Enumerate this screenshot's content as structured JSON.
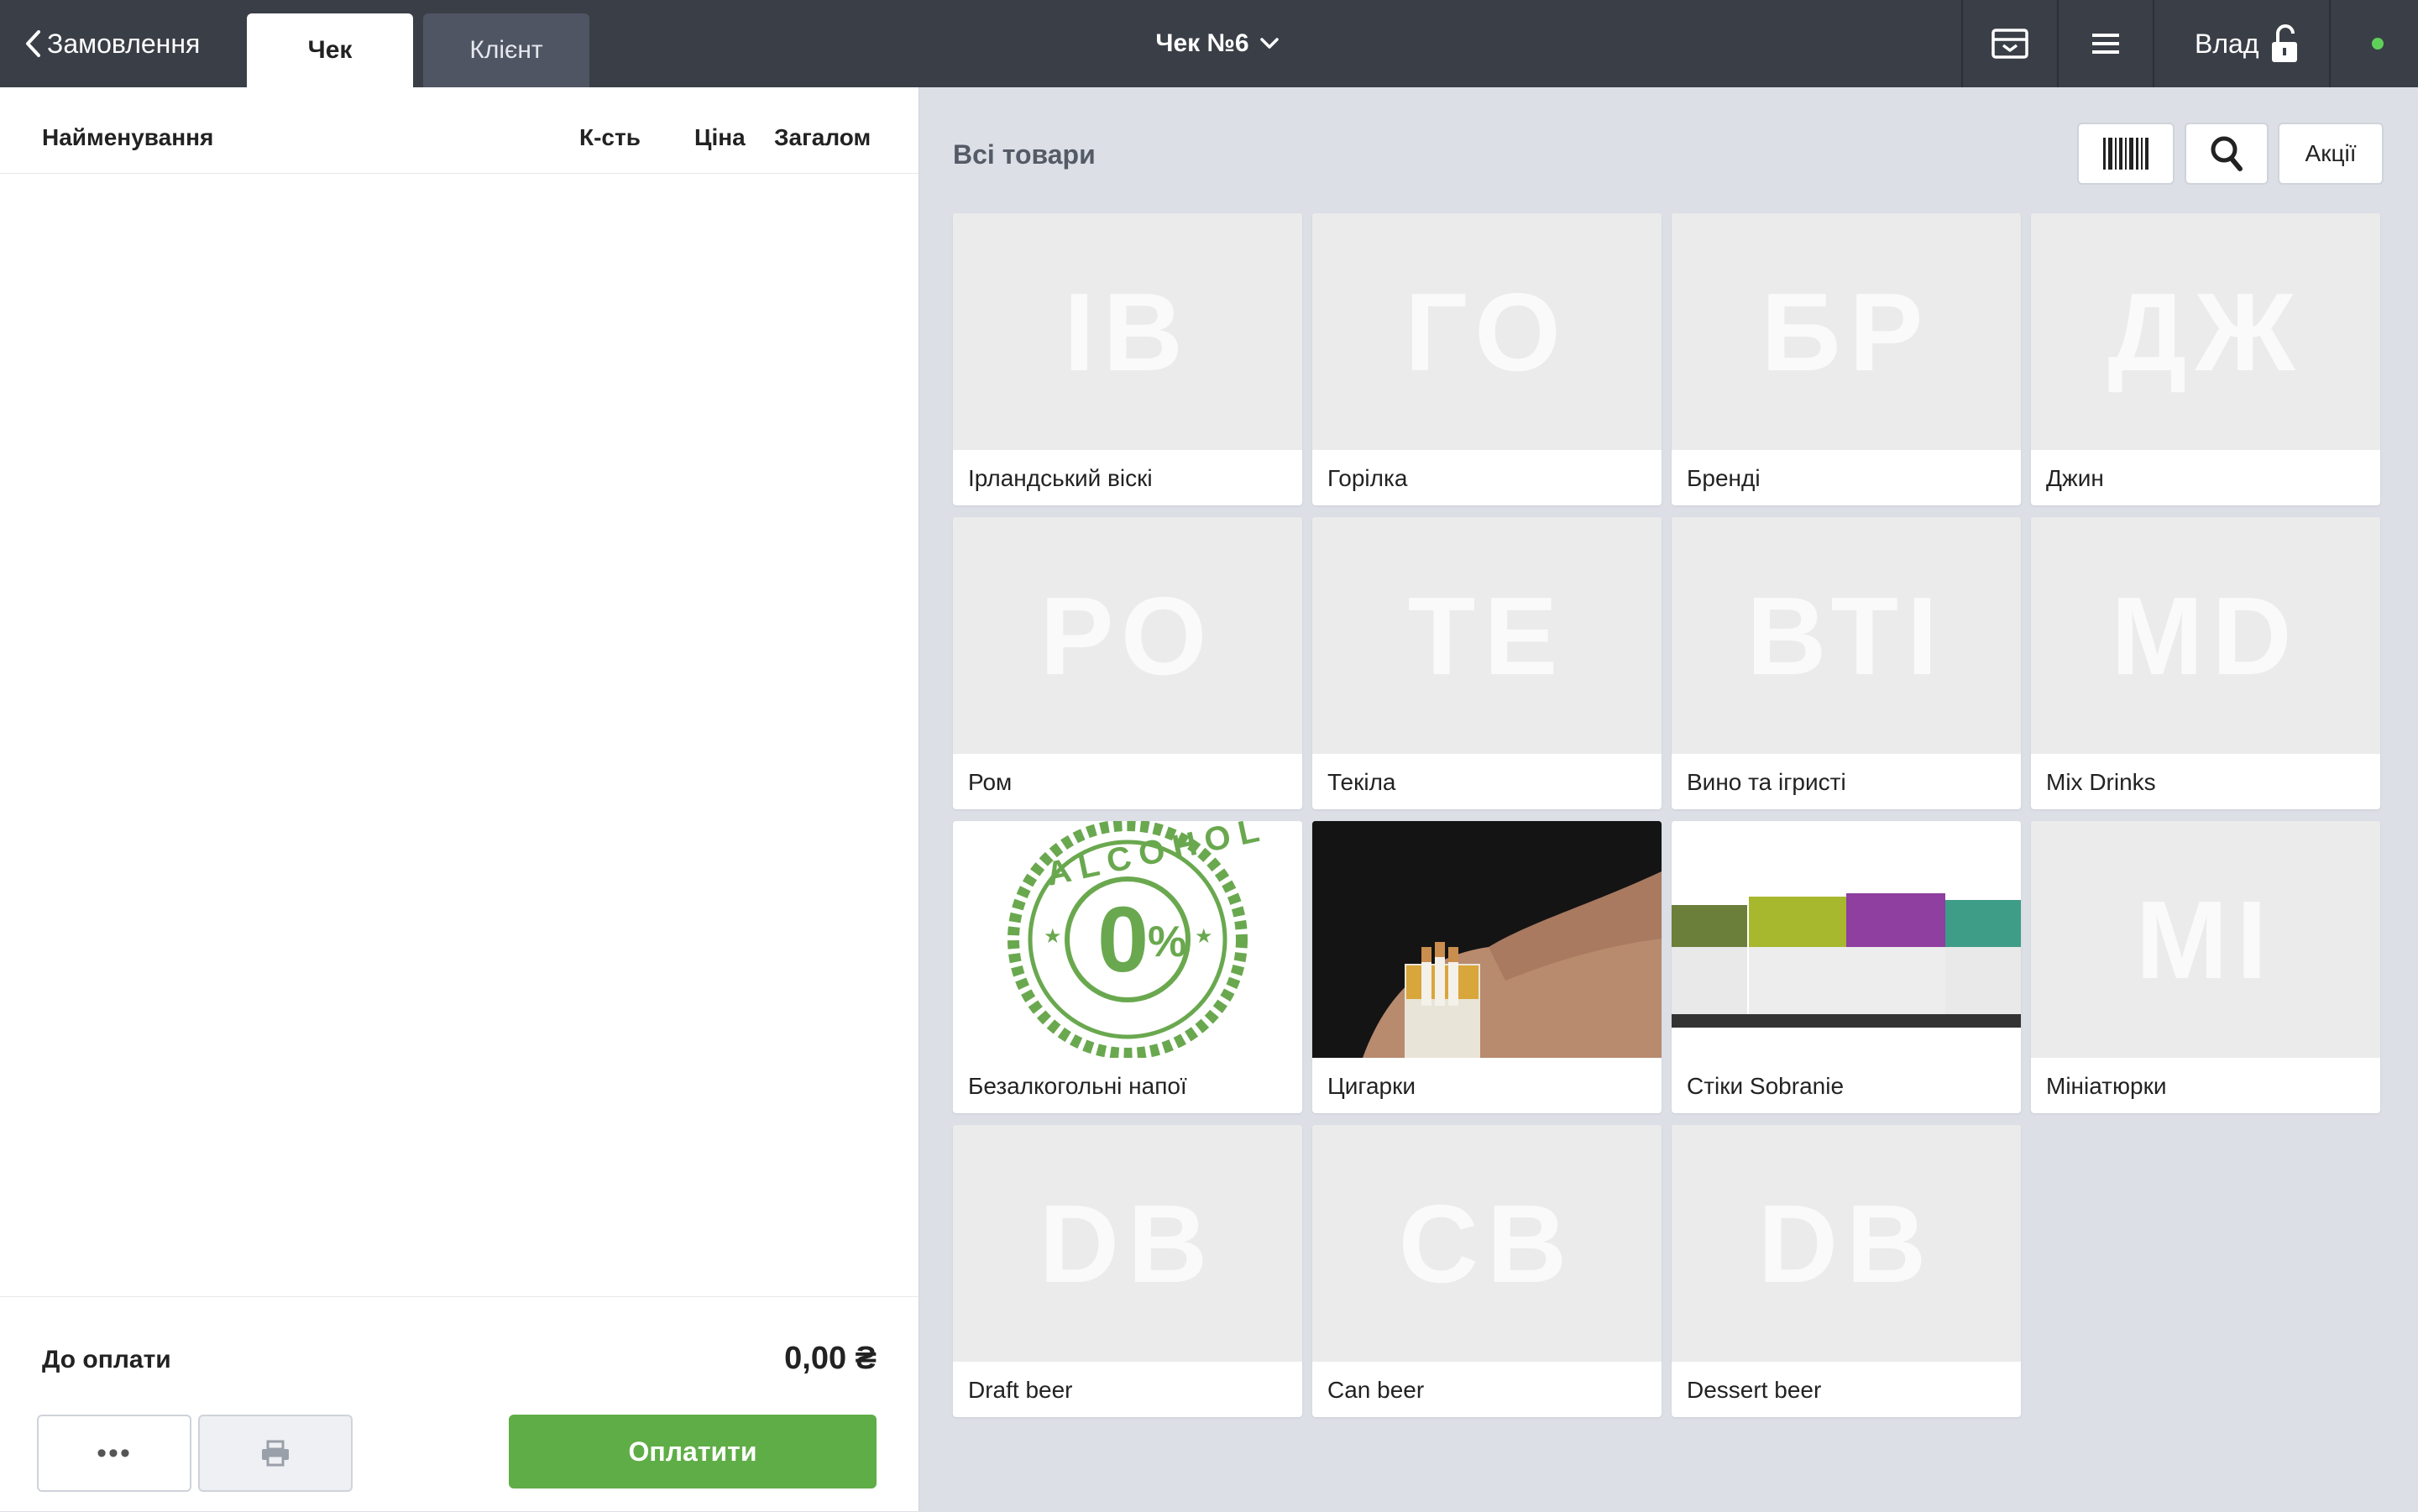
{
  "topbar": {
    "back_label": "Замовлення",
    "tabs": [
      "Чек",
      "Клієнт"
    ],
    "title": "Чек №6",
    "user": "Влад",
    "status_color": "#5fd15a"
  },
  "receipt": {
    "columns": {
      "name": "Найменування",
      "qty": "К-сть",
      "price": "Ціна",
      "total": "Загалом"
    },
    "due_label": "До оплати",
    "due_value": "0,00 ₴",
    "more_label": "•••",
    "pay_label": "Оплатити"
  },
  "catalog": {
    "title": "Всі товари",
    "promo_label": "Акції",
    "categories": [
      {
        "abbr": "ІВ",
        "name": "Ірландський віскі"
      },
      {
        "abbr": "ГО",
        "name": "Горілка"
      },
      {
        "abbr": "БР",
        "name": "Бренді"
      },
      {
        "abbr": "ДЖ",
        "name": "Джин"
      },
      {
        "abbr": "РО",
        "name": "Ром"
      },
      {
        "abbr": "ТЕ",
        "name": "Текіла"
      },
      {
        "abbr": "ВТІ",
        "name": "Вино та ігристі"
      },
      {
        "abbr": "MD",
        "name": "Mix Drinks"
      },
      {
        "abbr": "",
        "name": "Безалкогольні напої",
        "image": "alcohol-0-badge"
      },
      {
        "abbr": "",
        "name": "Цигарки",
        "image": "cigarettes-photo"
      },
      {
        "abbr": "",
        "name": "Стіки Sobranie",
        "image": "sobranie-packs-photo"
      },
      {
        "abbr": "MI",
        "name": "Мініатюрки"
      },
      {
        "abbr": "DB",
        "name": "Draft beer"
      },
      {
        "abbr": "CB",
        "name": "Can beer"
      },
      {
        "abbr": "DB",
        "name": "Dessert beer"
      }
    ]
  }
}
